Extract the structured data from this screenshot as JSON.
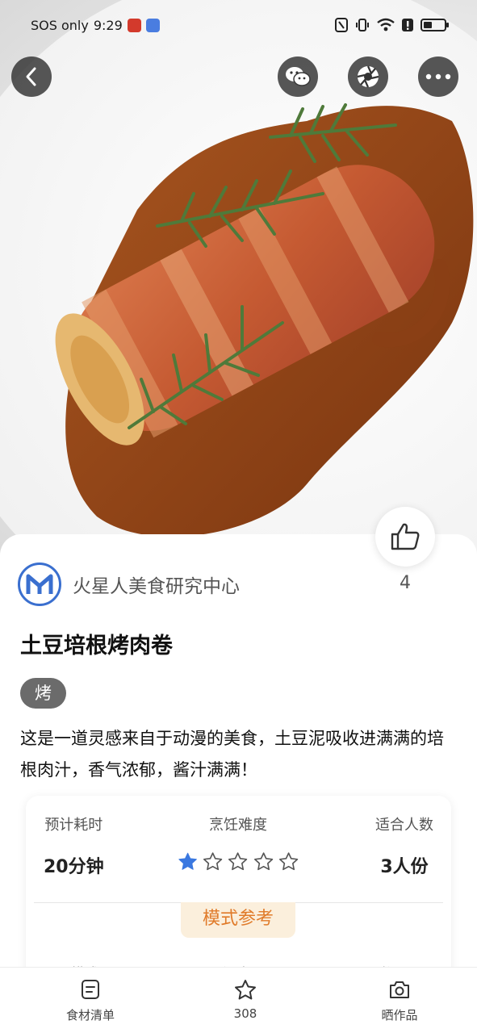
{
  "status_bar": {
    "carrier_text": "SOS only",
    "time": "9:29",
    "right_icons": [
      "nfc-icon",
      "vibrate-icon",
      "wifi-icon",
      "alert-icon",
      "battery-icon"
    ]
  },
  "nav": {
    "back_icon": "back-icon",
    "share_icon": "wechat-icon",
    "camera_icon": "shutter-icon",
    "more_icon": "more-icon"
  },
  "likes": {
    "count": "4"
  },
  "author": {
    "name": "火星人美食研究中心"
  },
  "recipe": {
    "title": "土豆培根烤肉卷",
    "tag": "烤",
    "description": "这是一道灵感来自于动漫的美食，土豆泥吸收进满满的培根肉汁，香气浓郁，酱汁满满！"
  },
  "info": {
    "time_label": "预计耗时",
    "time_value": "20分钟",
    "difficulty_label": "烹饪难度",
    "difficulty_rating": 1,
    "difficulty_max": 5,
    "servings_label": "适合人数",
    "servings_value": "3人份",
    "mode_label": "模式参考",
    "peek_labels": [
      "模式",
      "温度",
      "时间"
    ]
  },
  "bottom_bar": {
    "tabs": [
      {
        "label": "食材清单",
        "icon": "list-icon"
      },
      {
        "label": "308",
        "icon": "star-icon"
      },
      {
        "label": "晒作品",
        "icon": "camera-icon"
      }
    ]
  },
  "colors": {
    "accent": "#e07b2a",
    "star": "#3a78e0",
    "avatar_ring": "#3a6fcf"
  }
}
